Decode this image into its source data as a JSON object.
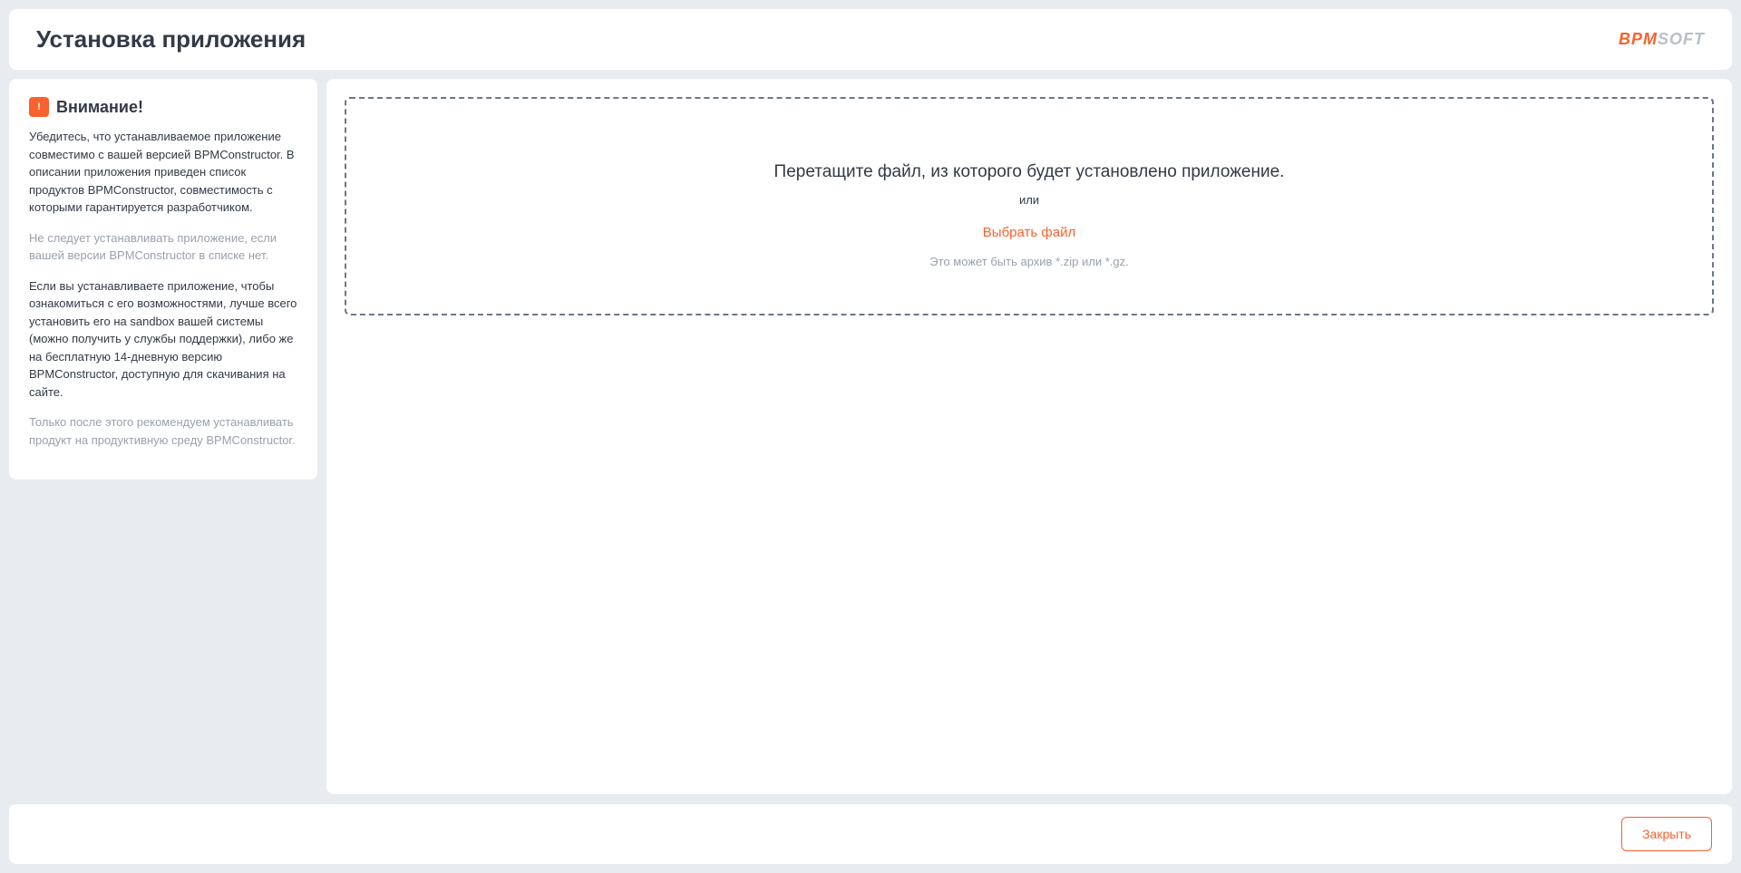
{
  "header": {
    "title": "Установка приложения",
    "logo_bpm": "BPM",
    "logo_soft": "SOFT"
  },
  "sidebar": {
    "alert_icon_glyph": "!",
    "alert_title": "Внимание!",
    "paragraphs": [
      {
        "text": "Убедитесь, что устанавливаемое приложение совместимо с вашей версией BPMConstructor. В описании приложения приведен список продуктов BPMConstructor, совместимость с которыми гарантируется разработчиком.",
        "tone": "dark"
      },
      {
        "text": "Не следует устанавливать приложение, если вашей версии BPMConstructor в списке нет.",
        "tone": "muted"
      },
      {
        "text": "Если вы устанавливаете приложение, чтобы ознакомиться с его возможностями, лучше всего установить его на sandbox вашей системы (можно получить у службы поддержки), либо же на бесплатную 14-дневную версию BPMConstructor, доступную для скачивания на сайте.",
        "tone": "dark"
      },
      {
        "text": "Только после этого рекомендуем устанавливать продукт на продуктивную среду BPMConstructor.",
        "tone": "muted"
      }
    ]
  },
  "dropzone": {
    "title": "Перетащите файл, из которого будет установлено приложение.",
    "or_label": "или",
    "select_label": "Выбрать файл",
    "hint": "Это может быть архив *.zip или *.gz."
  },
  "footer": {
    "close_label": "Закрыть"
  }
}
